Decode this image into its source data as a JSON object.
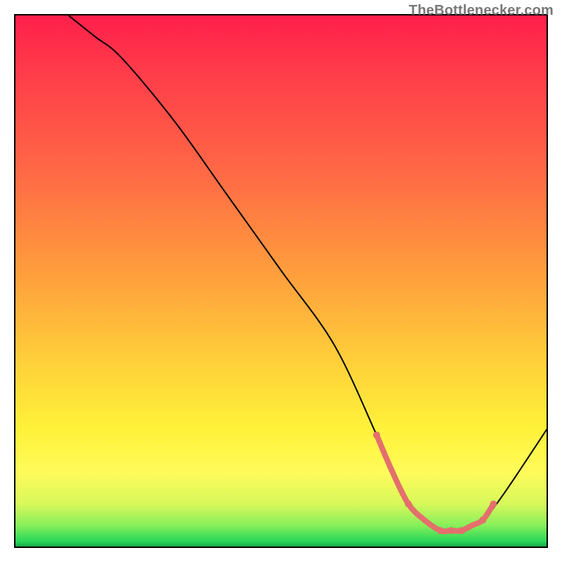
{
  "watermark": {
    "text": "TheBottlenecker.com"
  },
  "colors": {
    "border": "#000000",
    "curve": "#000000",
    "highlight": "#e46f6c",
    "watermark_text": "#777777"
  },
  "chart_data": {
    "type": "line",
    "title": "",
    "xlabel": "",
    "ylabel": "",
    "xlim": [
      0,
      100
    ],
    "ylim": [
      0,
      100
    ],
    "grid": false,
    "series": [
      {
        "name": "bottleneck-curve",
        "x": [
          10,
          15,
          20,
          30,
          40,
          50,
          60,
          68,
          72,
          76,
          80,
          82,
          84,
          88,
          92,
          100
        ],
        "values": [
          100,
          96,
          92,
          80,
          66,
          52,
          38,
          21,
          12,
          6,
          3,
          3,
          3,
          5,
          10,
          22
        ]
      }
    ],
    "highlight": {
      "name": "optimal-range",
      "x_range": [
        68,
        90
      ],
      "points_x": [
        68,
        71,
        74,
        77,
        80,
        82,
        84,
        86,
        88,
        90
      ],
      "points_y": [
        21,
        14,
        8,
        5,
        3,
        3,
        3,
        4,
        5,
        8
      ]
    }
  }
}
